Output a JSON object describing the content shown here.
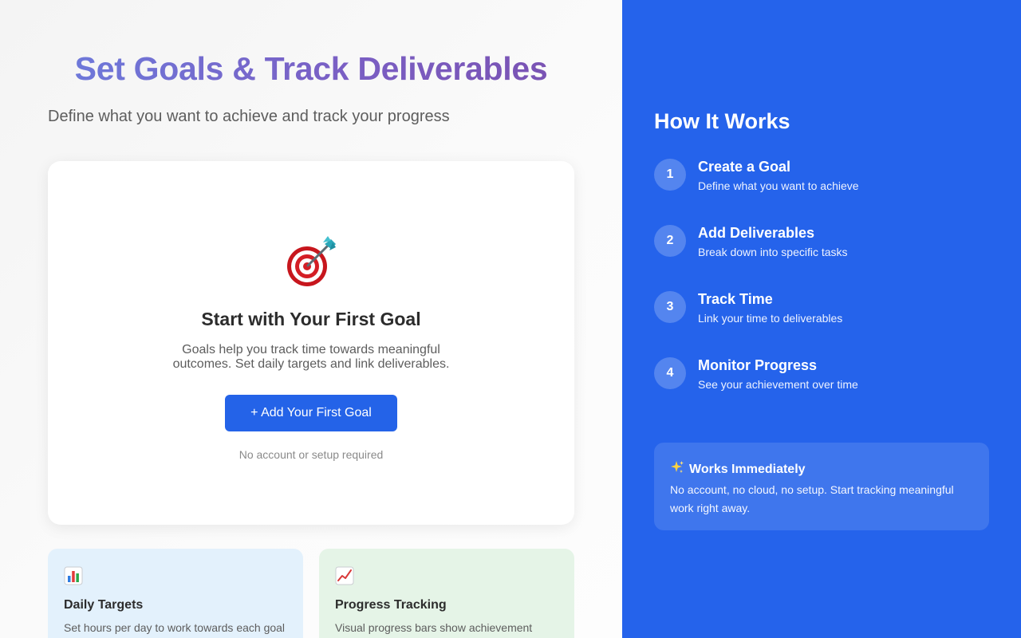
{
  "hero": {
    "title": "Set Goals & Track Deliverables",
    "subtitle": "Define what you want to achieve and track your progress"
  },
  "empty_state": {
    "icon": "target-dart-icon",
    "title": "Start with Your First Goal",
    "description": "Goals help you track time towards meaningful outcomes. Set daily targets and link deliverables.",
    "button_label": "+ Add Your First Goal",
    "note": "No account or setup required"
  },
  "features": [
    {
      "icon": "bar-chart-icon",
      "title": "Daily Targets",
      "description": "Set hours per day to work towards each goal"
    },
    {
      "icon": "trend-up-chart-icon",
      "title": "Progress Tracking",
      "description": "Visual progress bars show achievement"
    }
  ],
  "sidebar": {
    "title": "How It Works",
    "steps": [
      {
        "number": "1",
        "title": "Create a Goal",
        "description": "Define what you want to achieve"
      },
      {
        "number": "2",
        "title": "Add Deliverables",
        "description": "Break down into specific tasks"
      },
      {
        "number": "3",
        "title": "Track Time",
        "description": "Link your time to deliverables"
      },
      {
        "number": "4",
        "title": "Monitor Progress",
        "description": "See your achievement over time"
      }
    ],
    "info": {
      "icon": "sparkles-icon",
      "title": "Works Immediately",
      "description": "No account, no cloud, no setup. Start tracking meaningful work right away."
    }
  },
  "colors": {
    "accent": "#2563eb",
    "button": "#2463e8",
    "title_gradient_start": "#6b7fdf",
    "title_gradient_end": "#7a4fae",
    "feature_blue_bg": "#e3f1fc",
    "feature_green_bg": "#e5f4e7"
  }
}
